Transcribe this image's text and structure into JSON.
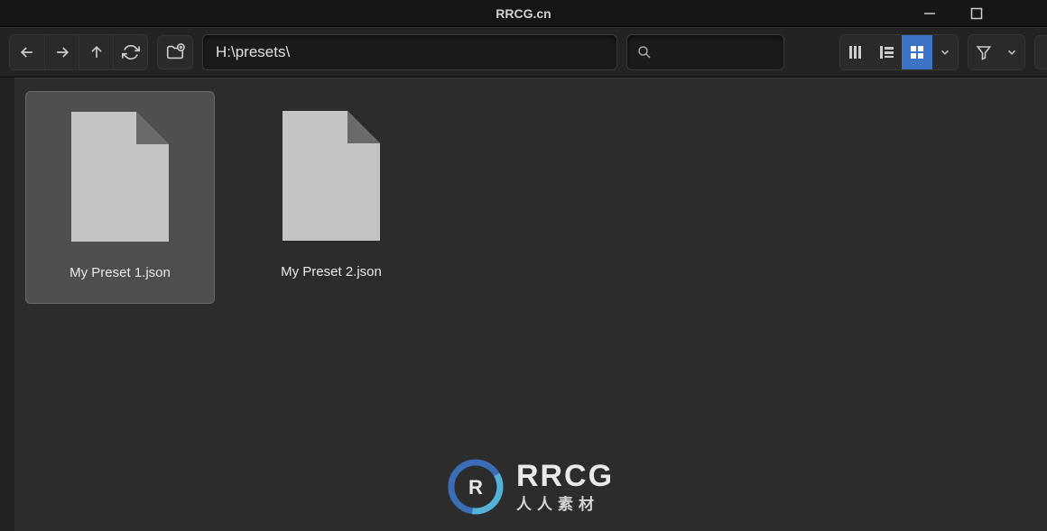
{
  "window": {
    "title": "RRCG.cn"
  },
  "toolbar": {
    "path": "H:\\presets\\",
    "search_placeholder": ""
  },
  "files": [
    {
      "name": "My Preset 1.json",
      "selected": true
    },
    {
      "name": "My Preset 2.json",
      "selected": false
    }
  ],
  "watermark": {
    "main": "RRCG",
    "sub": "人人素材"
  }
}
